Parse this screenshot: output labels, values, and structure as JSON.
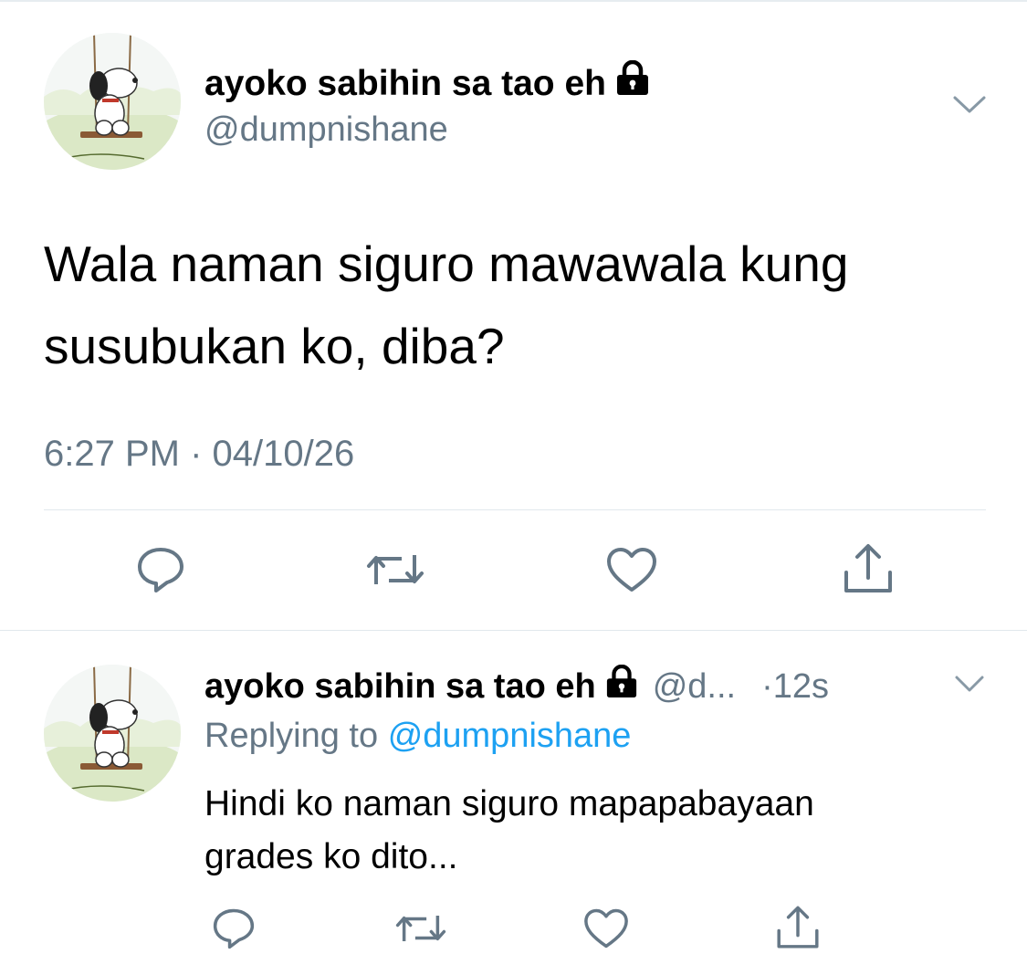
{
  "main_tweet": {
    "display_name": "ayoko sabihin sa tao eh",
    "handle": "@dumpnishane",
    "text_line1": "Wala naman siguro mawawala kung",
    "text_line2": "susubukan ko, diba?",
    "timestamp": "6:27 PM · 04/10/26",
    "icons": {
      "avatar": "snoopy-swing-avatar",
      "protected": "lock-icon",
      "menu": "chevron-down-icon",
      "reply": "reply-icon",
      "retweet": "retweet-icon",
      "like": "heart-icon",
      "share": "share-icon"
    }
  },
  "reply_tweet": {
    "display_name": "ayoko sabihin sa tao eh",
    "handle_truncated": "@d...",
    "time_ago": "·12s",
    "replying_prefix": "Replying to",
    "replying_handle": "@dumpnishane",
    "text_line1": "Hindi ko naman siguro mapapabayaan",
    "text_line2": "grades ko dito..."
  },
  "colors": {
    "text": "#000000",
    "secondary": "#657786",
    "link": "#1da1f2",
    "icon": "#657786",
    "divider": "#e1e8ed"
  }
}
